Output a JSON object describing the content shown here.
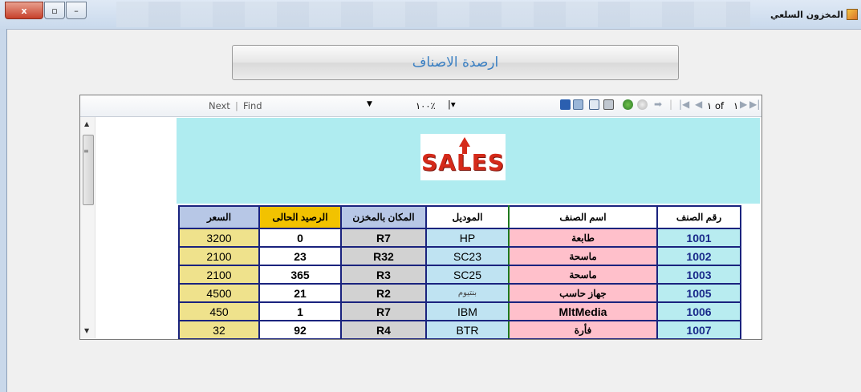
{
  "window": {
    "title": "المخزون السلعي",
    "close_label": "x",
    "maximize_label": "▫",
    "minimize_label": "–"
  },
  "header": {
    "title": "ارصدة الاصناف"
  },
  "toolbar": {
    "next_label": "Next",
    "separator": "|",
    "find_label": "Find",
    "zoom_value": "١٠٠٪",
    "page_current": "١",
    "page_of_label": "of",
    "page_total": "١"
  },
  "logo": {
    "text": "SALES"
  },
  "table": {
    "columns": [
      "السعر",
      "الرصيد الحالى",
      "المكان بالمخزن",
      "الموديل",
      "اسم الصنف",
      "رقم الصنف"
    ],
    "rows": [
      {
        "price": "3200",
        "balance": "0",
        "location": "R7",
        "model": "HP",
        "name": "طابعة",
        "code": "1001"
      },
      {
        "price": "2100",
        "balance": "23",
        "location": "R32",
        "model": "SC23",
        "name": "ماسحة",
        "code": "1002"
      },
      {
        "price": "2100",
        "balance": "365",
        "location": "R3",
        "model": "SC25",
        "name": "ماسحة",
        "code": "1003"
      },
      {
        "price": "4500",
        "balance": "21",
        "location": "R2",
        "model": "بنتيوم",
        "name": "جهاز حاسب",
        "code": "1005"
      },
      {
        "price": "450",
        "balance": "1",
        "location": "R7",
        "model": "IBM",
        "name": "MltMedia",
        "code": "1006"
      },
      {
        "price": "32",
        "balance": "92",
        "location": "R4",
        "model": "BTR",
        "name": "فأرة",
        "code": "1007"
      }
    ]
  },
  "colors": {
    "banner": "#afecf0",
    "header_text": "#3a7fc2",
    "balance_header": "#f2c200",
    "name_cell": "#ffc0cb",
    "price_cell": "#efe28c"
  }
}
